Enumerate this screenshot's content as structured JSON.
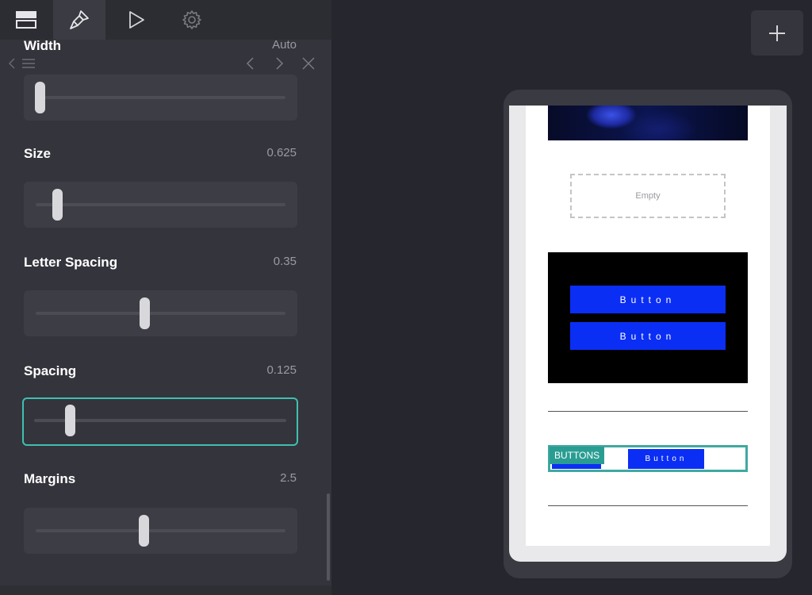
{
  "toolbar": {
    "tabs": [
      {
        "name": "layout",
        "icon": "layout-icon"
      },
      {
        "name": "style",
        "icon": "paintbrush-icon",
        "active": true
      },
      {
        "name": "preview",
        "icon": "play-icon"
      },
      {
        "name": "settings",
        "icon": "gear-icon"
      }
    ]
  },
  "properties": [
    {
      "label": "Width",
      "value": "Auto",
      "position": 0.02
    },
    {
      "label": "Size",
      "value": "0.625",
      "position": 0.09
    },
    {
      "label": "Letter Spacing",
      "value": "0.35",
      "position": 0.435
    },
    {
      "label": "Spacing",
      "value": "0.125",
      "position": 0.13,
      "focused": true
    },
    {
      "label": "Margins",
      "value": "2.5",
      "position": 0.43
    }
  ],
  "preview": {
    "empty_placeholder": "Empty",
    "button_label_1": "Button",
    "button_label_2": "Button",
    "buttons_tag": "BUTTONS",
    "row_button_1": "n",
    "row_button_2": "Button"
  },
  "colors": {
    "accent": "#3fbfb0",
    "button_blue": "#0b2ef5",
    "panel_bg": "#34343c",
    "workspace_bg": "#26262e"
  }
}
